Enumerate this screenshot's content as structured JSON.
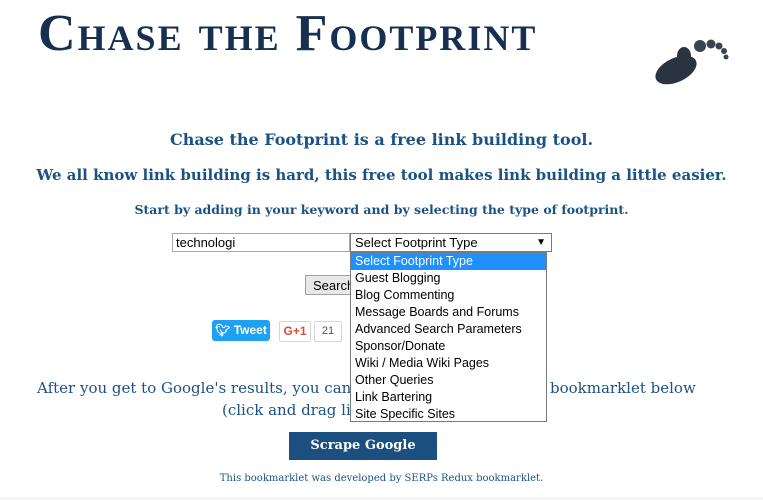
{
  "header": {
    "title": "Chase the Footprint"
  },
  "intro": {
    "line1": "Chase the Footprint is a free link building tool.",
    "line2": "We all know link building is hard, this free tool makes link building a little easier.",
    "line3": "Start by adding in your keyword and by selecting the type of footprint."
  },
  "form": {
    "keyword_value": "technologi",
    "select_value": "Select Footprint Type",
    "search_label": "Search",
    "options": [
      "Select Footprint Type",
      "Guest Blogging",
      "Blog Commenting",
      "Message Boards and Forums",
      "Advanced Search Parameters",
      "Sponsor/Donate",
      "Wiki / Media Wiki Pages",
      "Other Queries",
      "Link Bartering",
      "Site Specific Sites"
    ],
    "selected_index": 0
  },
  "social": {
    "tweet_label": "Tweet",
    "gplus_label": "G+1",
    "gplus_count": "21"
  },
  "bookmarklet": {
    "text_left": "After you get to Google's results, you can exp",
    "text_right": "bookmarklet below",
    "text_line2": "(click and drag lin",
    "button_label": "Scrape Google Results",
    "credit": "This bookmarklet was developed by SERPs Redux bookmarklet."
  },
  "icons": {
    "logo": "footprint-icon",
    "select_arrow": "chevron-down-icon",
    "twitter": "twitter-bird-icon"
  },
  "colors": {
    "title": "#172f50",
    "text": "#1a5285",
    "highlight": "#1e90ff",
    "button": "#1a4f80",
    "tweet": "#1da1f2"
  }
}
